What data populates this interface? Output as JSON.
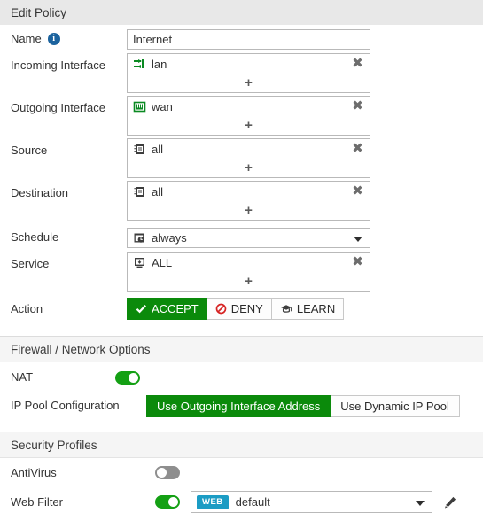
{
  "window": {
    "title": "Edit Policy"
  },
  "policy": {
    "name": {
      "label": "Name",
      "value": "Internet",
      "info_icon": "info-icon",
      "info_glyph": "i"
    },
    "incoming_interface": {
      "label": "Incoming Interface",
      "value": "lan",
      "icon": "switch-icon",
      "remove_glyph": "✖",
      "add_glyph": "+"
    },
    "outgoing_interface": {
      "label": "Outgoing Interface",
      "value": "wan",
      "icon": "ethernet-port-icon",
      "remove_glyph": "✖",
      "add_glyph": "+"
    },
    "source": {
      "label": "Source",
      "value": "all",
      "icon": "address-object-icon",
      "remove_glyph": "✖",
      "add_glyph": "+"
    },
    "destination": {
      "label": "Destination",
      "value": "all",
      "icon": "address-object-icon",
      "remove_glyph": "✖",
      "add_glyph": "+"
    },
    "schedule": {
      "label": "Schedule",
      "value": "always",
      "icon": "schedule-clock-icon"
    },
    "service": {
      "label": "Service",
      "value": "ALL",
      "icon": "service-icon",
      "remove_glyph": "✖",
      "add_glyph": "+"
    },
    "action": {
      "label": "Action",
      "selected": "ACCEPT",
      "options": [
        {
          "label": "ACCEPT",
          "icon": "check-icon",
          "selected": true
        },
        {
          "label": "DENY",
          "icon": "deny-icon",
          "selected": false
        },
        {
          "label": "LEARN",
          "icon": "graduation-cap-icon",
          "selected": false
        }
      ]
    }
  },
  "firewall_options": {
    "heading": "Firewall / Network Options",
    "nat": {
      "label": "NAT",
      "state": "on"
    },
    "ip_pool": {
      "label": "IP Pool Configuration",
      "selected": "Use Outgoing Interface Address",
      "options": [
        {
          "label": "Use Outgoing Interface Address",
          "selected": true
        },
        {
          "label": "Use Dynamic IP Pool",
          "selected": false
        }
      ]
    }
  },
  "security_profiles": {
    "heading": "Security Profiles",
    "antivirus": {
      "label": "AntiVirus",
      "state": "off"
    },
    "web_filter": {
      "label": "Web Filter",
      "state": "on",
      "badge": "WEB",
      "profile": "default",
      "edit_icon": "pencil-icon"
    }
  },
  "colors": {
    "accent_green": "#0b8a0b",
    "toggle_green": "#14a014",
    "badge_teal": "#1b9cc4",
    "info_blue": "#1c639e",
    "deny_red": "#d62222",
    "header_gray": "#e8e8e8",
    "section_gray": "#f5f5f5"
  }
}
